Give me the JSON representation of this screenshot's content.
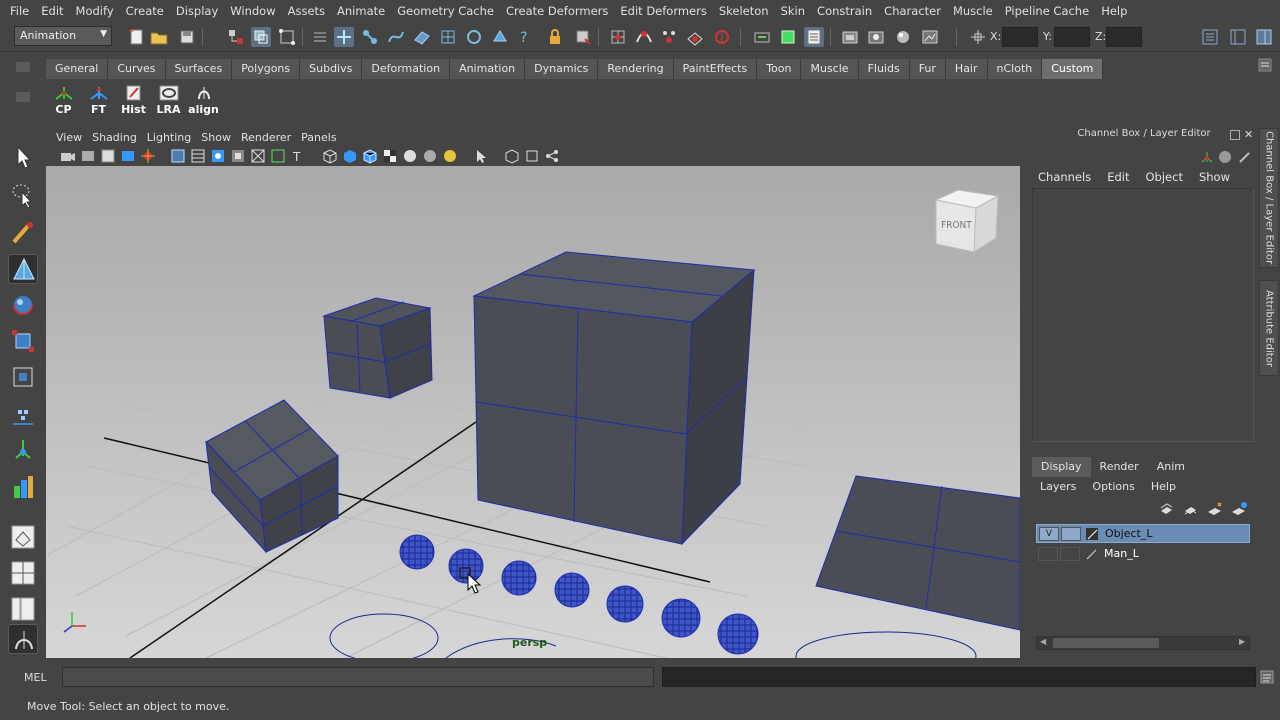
{
  "menubar": [
    "File",
    "Edit",
    "Modify",
    "Create",
    "Display",
    "Window",
    "Assets",
    "Animate",
    "Geometry Cache",
    "Create Deformers",
    "Edit Deformers",
    "Skeleton",
    "Skin",
    "Constrain",
    "Character",
    "Muscle",
    "Pipeline Cache",
    "Help"
  ],
  "statusline": {
    "mode": "Animation",
    "x_label": "X:",
    "y_label": "Y:",
    "z_label": "Z:"
  },
  "shelf": {
    "tabs": [
      "General",
      "Curves",
      "Surfaces",
      "Polygons",
      "Subdivs",
      "Deformation",
      "Animation",
      "Dynamics",
      "Rendering",
      "PaintEffects",
      "Toon",
      "Muscle",
      "Fluids",
      "Fur",
      "Hair",
      "nCloth",
      "Custom"
    ],
    "active_tab": "Custom",
    "buttons": [
      "CP",
      "FT",
      "Hist",
      "LRA",
      "align"
    ]
  },
  "panel_menu": [
    "View",
    "Shading",
    "Lighting",
    "Show",
    "Renderer",
    "Panels"
  ],
  "viewport": {
    "camera_label": "persp",
    "viewcube_label": "FRONT"
  },
  "channel_box": {
    "title": "Channel Box / Layer Editor",
    "menu": [
      "Channels",
      "Edit",
      "Object",
      "Show"
    ],
    "side_tabs": [
      "Channel Box / Layer Editor",
      "Attribute Editor"
    ]
  },
  "layer_editor": {
    "tabs": [
      "Display",
      "Render",
      "Anim"
    ],
    "active_tab": "Display",
    "menu": [
      "Layers",
      "Options",
      "Help"
    ],
    "layers": [
      {
        "visibility": "V",
        "name": "Object_L",
        "selected": true
      },
      {
        "visibility": "",
        "name": "Man_L",
        "selected": false
      }
    ]
  },
  "command_line": {
    "label": "MEL",
    "value": ""
  },
  "help_line": "Move Tool: Select an object to move.",
  "colors": {
    "ui_bg": "#444444",
    "viewport_top": "#ababab",
    "viewport_bottom": "#d3d3d3",
    "mesh_face": "#4a4d55",
    "wire": "#1f2bb0",
    "layer_selected": "#6a8db5"
  }
}
